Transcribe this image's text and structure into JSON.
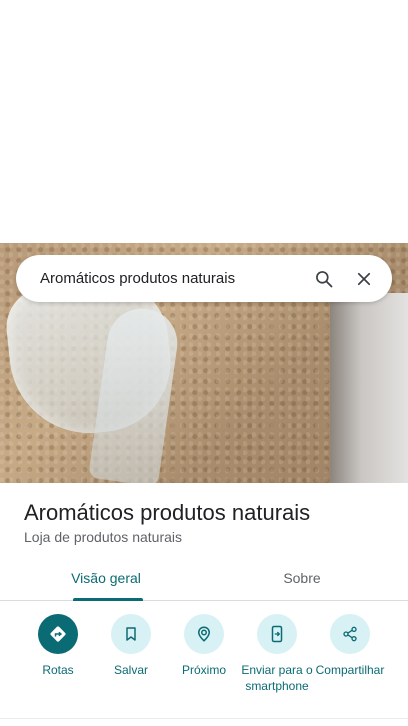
{
  "search": {
    "query": "Aromáticos produtos naturais"
  },
  "place": {
    "name": "Aromáticos produtos naturais",
    "category": "Loja de produtos naturais"
  },
  "tabs": [
    {
      "label": "Visão geral",
      "active": true
    },
    {
      "label": "Sobre",
      "active": false
    }
  ],
  "actions": [
    {
      "label": "Rotas",
      "icon": "directions-icon"
    },
    {
      "label": "Salvar",
      "icon": "bookmark-icon"
    },
    {
      "label": "Próximo",
      "icon": "nearby-icon"
    },
    {
      "label": "Enviar para o smartphone",
      "icon": "send-to-phone-icon"
    },
    {
      "label": "Compartilhar",
      "icon": "share-icon"
    }
  ],
  "colors": {
    "accent": "#0b6b74",
    "chip": "#d8f1f4"
  }
}
